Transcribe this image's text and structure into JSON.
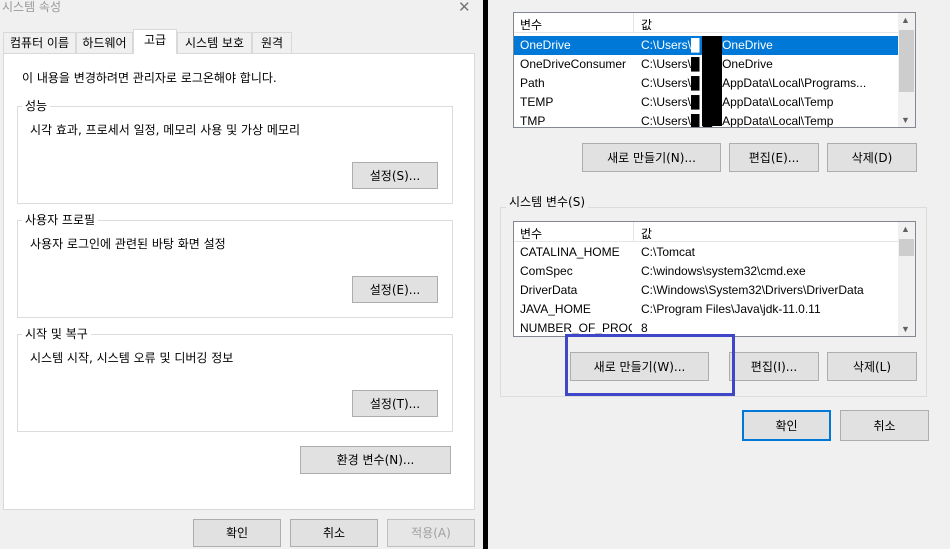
{
  "left": {
    "title": "시스템 속성",
    "close": "✕",
    "tabs": [
      "컴퓨터 이름",
      "하드웨어",
      "고급",
      "시스템 보호",
      "원격"
    ],
    "notice": "이 내용을 변경하려면 관리자로 로그온해야 합니다.",
    "groups": {
      "performance": {
        "label": "성능",
        "desc": "시각 효과, 프로세서 일정, 메모리 사용 및 가상 메모리",
        "button": "설정(S)..."
      },
      "profile": {
        "label": "사용자 프로필",
        "desc": "사용자 로그인에 관련된 바탕 화면 설정",
        "button": "설정(E)..."
      },
      "startup": {
        "label": "시작 및 복구",
        "desc": "시스템 시작, 시스템 오류 및 디버깅 정보",
        "button": "설정(T)..."
      }
    },
    "env_button": "환경 변수(N)...",
    "ok": "확인",
    "cancel": "취소",
    "apply": "적용(A)"
  },
  "right": {
    "user_vars": {
      "headers": [
        "변수",
        "값"
      ],
      "rows": [
        [
          "OneDrive",
          "C:\\Users\\█  ▇0\\OneDrive"
        ],
        [
          "OneDriveConsumer",
          "C:\\Users\\█  ▇0\\OneDrive"
        ],
        [
          "Path",
          "C:\\Users\\█  ▇0\\AppData\\Local\\Programs..."
        ],
        [
          "TEMP",
          "C:\\Users\\█  ▇0\\AppData\\Local\\Temp"
        ],
        [
          "TMP",
          "C:\\Users\\█  ▇0\\AppData\\Local\\Temp"
        ]
      ],
      "new": "새로 만들기(N)...",
      "edit": "편집(E)...",
      "delete": "삭제(D)"
    },
    "sys_label": "시스템 변수(S)",
    "sys_vars": {
      "headers": [
        "변수",
        "값"
      ],
      "rows": [
        [
          "CATALINA_HOME",
          "C:\\Tomcat"
        ],
        [
          "ComSpec",
          "C:\\windows\\system32\\cmd.exe"
        ],
        [
          "DriverData",
          "C:\\Windows\\System32\\Drivers\\DriverData"
        ],
        [
          "JAVA_HOME",
          "C:\\Program Files\\Java\\jdk-11.0.11"
        ],
        [
          "NUMBER_OF_PROC...",
          "8"
        ]
      ],
      "new": "새로 만들기(W)...",
      "edit": "편집(I)...",
      "delete": "삭제(L)"
    },
    "ok": "확인",
    "cancel": "취소"
  },
  "colors": {
    "selection": "#0078d7",
    "highlight": "#4046c8"
  }
}
